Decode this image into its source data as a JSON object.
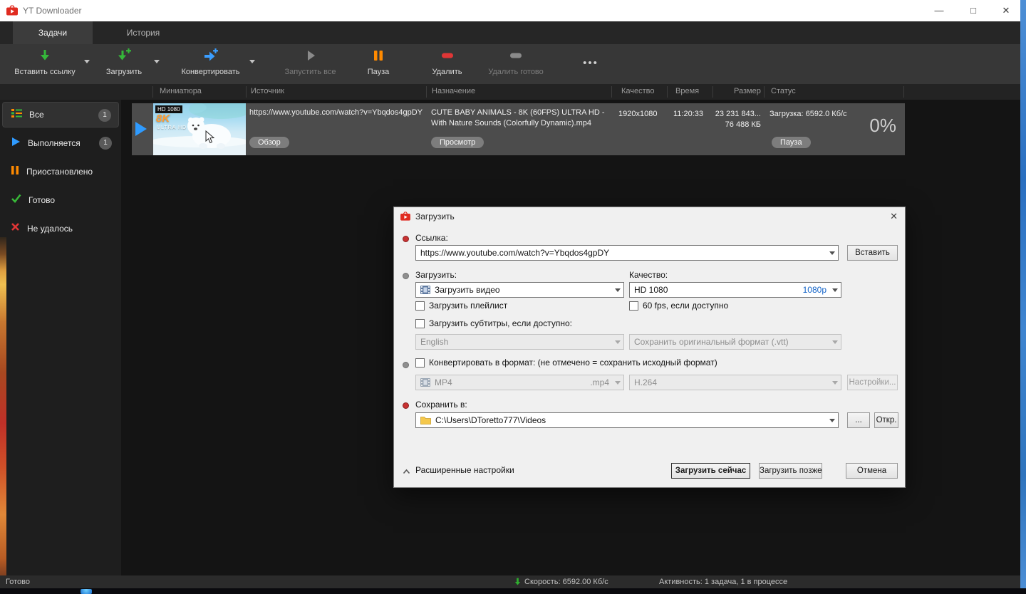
{
  "icons": {
    "minimize": "—",
    "maximize": "□",
    "close": "✕",
    "dialog_close": "✕",
    "ellipsis": "•••"
  },
  "window": {
    "title": "YT Downloader"
  },
  "tabs": {
    "tasks": "Задачи",
    "history": "История"
  },
  "toolbar": {
    "paste_link": "Вставить ссылку",
    "download": "Загрузить",
    "convert": "Конвертировать",
    "start_all": "Запустить все",
    "pause": "Пауза",
    "delete": "Удалить",
    "delete_done": "Удалить готово"
  },
  "columns": [
    "Миниатюра",
    "Источник",
    "Назначение",
    "Качество",
    "Время",
    "Размер",
    "Статус"
  ],
  "sidebar": {
    "items": [
      {
        "label": "Все",
        "badge": "1"
      },
      {
        "label": "Выполняется",
        "badge": "1"
      },
      {
        "label": "Приостановлено"
      },
      {
        "label": "Готово"
      },
      {
        "label": "Не удалось"
      }
    ]
  },
  "task": {
    "thumb": {
      "badge": "HD 1080",
      "k8": "8K",
      "ultra": "ULTRA HD"
    },
    "source_url": "https://www.youtube.com/watch?v=Ybqdos4gpDY",
    "source_button": "Обзор",
    "dest_name": "CUTE BABY ANIMALS - 8K (60FPS) ULTRA HD - With Nature Sounds (Colorfully Dynamic).mp4",
    "dest_button": "Просмотр",
    "quality": "1920x1080",
    "time": "11:20:33",
    "size_line1": "23 231 843...",
    "size_line2": "76 488 КБ",
    "status_text": "Загрузка: 6592.0 Кб/с",
    "progress": "0%",
    "status_button": "Пауза"
  },
  "dialog": {
    "title": "Загрузить",
    "link_label": "Ссылка:",
    "link_value": "https://www.youtube.com/watch?v=Ybqdos4gpDY",
    "paste_button": "Вставить",
    "download_label": "Загрузить:",
    "quality_label": "Качество:",
    "download_value": "Загрузить видео",
    "quality_value": "HD 1080",
    "quality_tag": "1080p",
    "playlist_checkbox": "Загрузить плейлист",
    "fps_checkbox": "60 fps, если доступно",
    "subtitles_checkbox": "Загрузить субтитры, если доступно:",
    "subtitles_lang": "English",
    "subtitles_format": "Сохранить оригинальный формат (.vtt)",
    "convert_checkbox": "Конвертировать в формат: (не отмечено = сохранить исходный формат)",
    "format_value": "MP4",
    "format_ext": ".mp4",
    "codec_value": "H.264",
    "settings_button": "Настройки...",
    "save_label": "Сохранить в:",
    "save_path": "C:\\Users\\DToretto777\\Videos",
    "browse_button": "...",
    "open_button": "Откр.",
    "advanced_label": "Расширенные настройки",
    "download_now": "Загрузить сейчас",
    "download_later": "Загрузить позже",
    "cancel": "Отмена"
  },
  "statusbar": {
    "left": "Готово",
    "speed": "Скорость: 6592.00 Кб/с",
    "activity": "Активность: 1 задача, 1 в процессе"
  },
  "accent_colors": {
    "green": "#35b83a",
    "blue": "#2f9bff",
    "orange": "#ff8a00",
    "red": "#e03636",
    "link_blue": "#1464c8"
  }
}
